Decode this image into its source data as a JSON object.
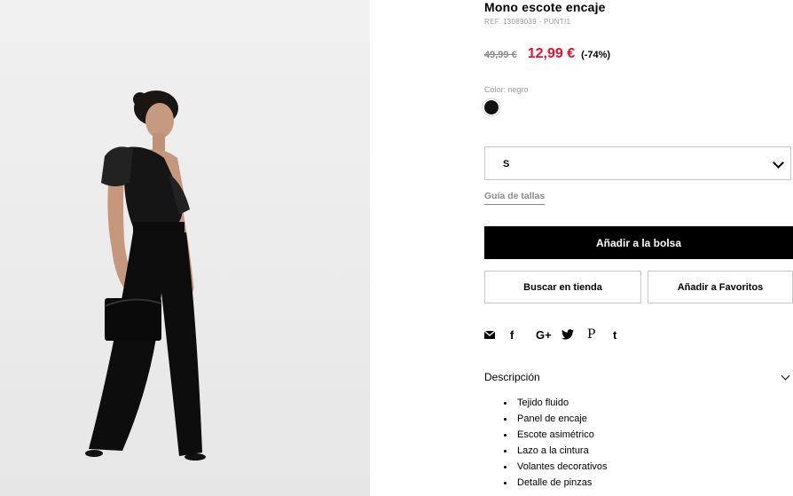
{
  "product": {
    "title": "Mono escote encaje",
    "ref": "REF. 13089039 - PUNTI1",
    "old_price": "49,99 €",
    "new_price": "12,99 €",
    "discount": "(-74%)",
    "color_label": "Color: negro",
    "color_swatch": "#111111",
    "price_color": "#e8112d"
  },
  "size_select": {
    "value": "S"
  },
  "size_guide": "Guía de tallas",
  "buttons": {
    "add_to_bag": "Añadir a la bolsa",
    "find_in_store": "Buscar en tienda",
    "add_to_favorites": "Añadir a Favoritos"
  },
  "share": {
    "email_icon": "email-icon",
    "facebook": "f",
    "google_plus": "G+",
    "twitter_icon": "twitter-icon",
    "pinterest": "P",
    "tumblr": "t"
  },
  "description": {
    "header": "Descripción",
    "items": [
      "Tejido fluido",
      "Panel de encaje",
      "Escote asimétrico",
      "Lazo a la cintura",
      "Volantes decorativos",
      "Detalle de pinzas"
    ]
  }
}
